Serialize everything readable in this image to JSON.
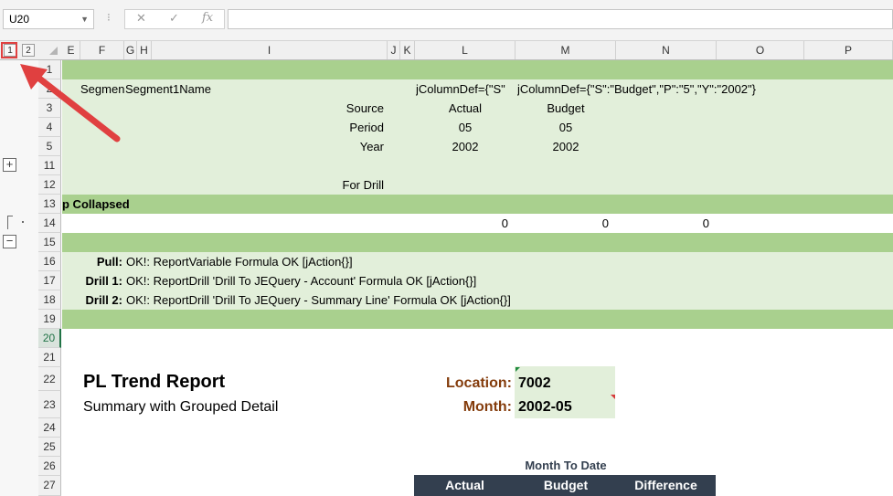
{
  "formula_bar": {
    "name_box": "U20",
    "cancel_icon": "✕",
    "enter_icon": "✓",
    "fx_label": "fx",
    "formula": ""
  },
  "outline": {
    "levels": [
      "1",
      "2"
    ],
    "expand_symbol": "+",
    "collapse_symbol": "−"
  },
  "columns": [
    "E",
    "F",
    "G",
    "H",
    "I",
    "J",
    "K",
    "L",
    "M",
    "N",
    "O",
    "P"
  ],
  "rows": {
    "r1": "1",
    "r2": "2",
    "r3": "3",
    "r4": "4",
    "r5": "5",
    "r11": "11",
    "r12": "12",
    "r13": "13",
    "r14": "14",
    "r15": "15",
    "r16": "16",
    "r17": "17",
    "r18": "18",
    "r19": "19",
    "r20": "20",
    "r21": "21",
    "r22": "22",
    "r23": "23",
    "r24": "24",
    "r25": "25",
    "r26": "26",
    "r27": "27"
  },
  "cells": {
    "f2": "Segment",
    "g2": "Segment1Name",
    "j2": "jColumnDef={\"S\"",
    "l2": "jColumnDef={\"S\":\"Budget\",\"P\":\"5\",\"Y\":\"2002\"}",
    "i3": "Source",
    "l3": "Actual",
    "m3": "Budget",
    "i4": "Period",
    "l4": "05",
    "m4": "05",
    "i5": "Year",
    "l5": "2002",
    "m5": "2002",
    "i12": "For Drill",
    "e13": "p Collapsed",
    "l14": "0",
    "m14": "0",
    "n14": "0",
    "f16": "Pull:",
    "g16": "OK!: ReportVariable Formula OK [jAction{}]",
    "f17": "Drill 1:",
    "g17": "OK!: ReportDrill 'Drill To JEQuery - Account' Formula OK [jAction{}]",
    "f18": "Drill 2:",
    "g18": "OK!: ReportDrill 'Drill To JEQuery - Summary Line' Formula OK [jAction{}]"
  },
  "report": {
    "title": "PL Trend Report",
    "subtitle": "Summary with Grouped Detail",
    "location_label": "Location:",
    "location_value": "7002",
    "month_label": "Month:",
    "month_value": "2002-05",
    "month_to_date": "Month To Date",
    "headers": [
      "Actual",
      "Budget",
      "Difference"
    ]
  },
  "colors": {
    "dark_green": "#a9d08e",
    "light_green": "#e2efda",
    "label_brown": "#843c0c",
    "table_header": "#333f4f",
    "annotation_red": "#e04040"
  }
}
